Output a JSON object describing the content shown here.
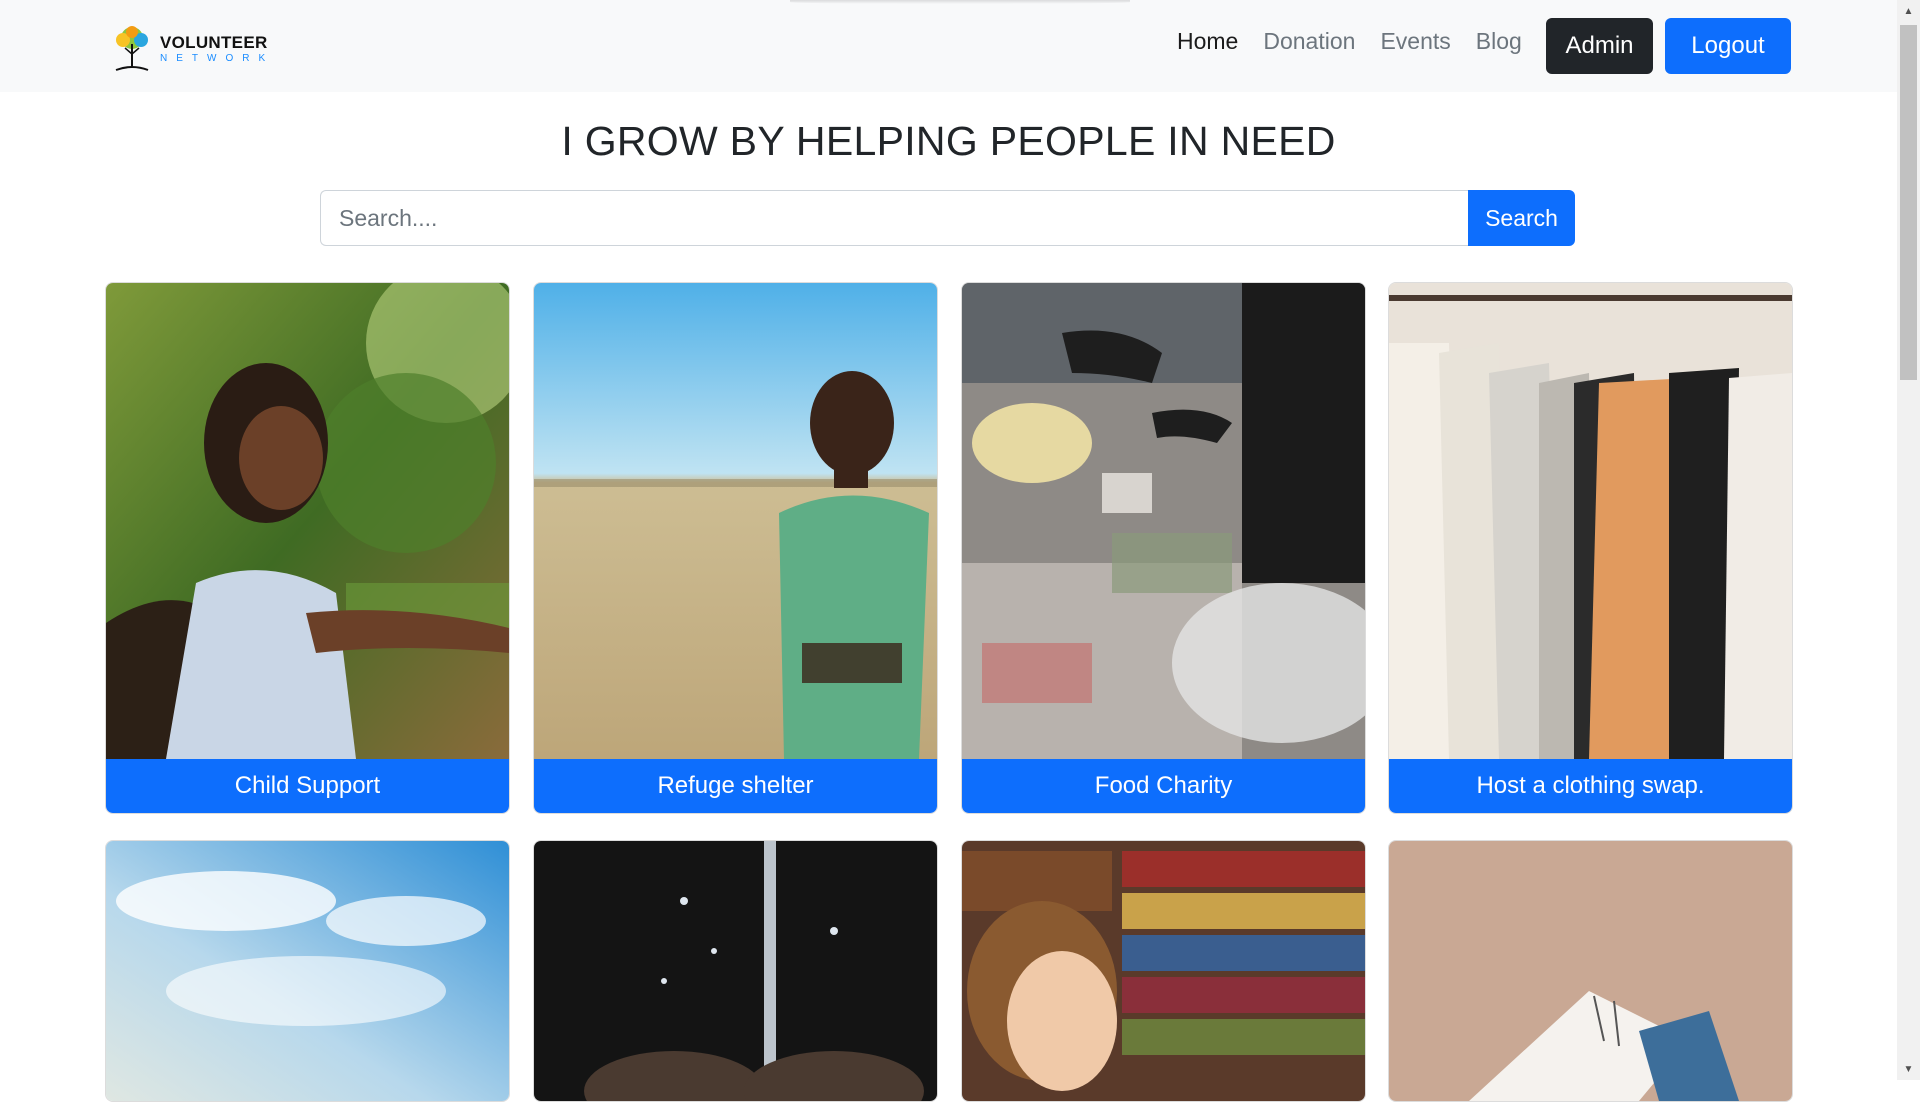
{
  "brand": {
    "title": "VOLUNTEER",
    "subtitle": "NETWORK"
  },
  "nav": {
    "links": [
      {
        "label": "Home",
        "active": true
      },
      {
        "label": "Donation"
      },
      {
        "label": "Events"
      },
      {
        "label": "Blog"
      }
    ],
    "admin_label": "Admin",
    "logout_label": "Logout"
  },
  "hero": {
    "title": "I GROW BY HELPING PEOPLE IN NEED"
  },
  "search": {
    "placeholder": "Search....",
    "button_label": "Search"
  },
  "cards": [
    {
      "label": "Child Support",
      "image": "girl-smiling-outdoors"
    },
    {
      "label": "Refuge shelter",
      "image": "boy-in-field"
    },
    {
      "label": "Food Charity",
      "image": "food-bank-volunteers"
    },
    {
      "label": "Host a clothing swap.",
      "image": "clothing-rack"
    },
    {
      "label": "",
      "image": "sky-clouds"
    },
    {
      "label": "",
      "image": "water-pouring-hands"
    },
    {
      "label": "",
      "image": "boy-in-library"
    },
    {
      "label": "",
      "image": "open-book"
    }
  ],
  "colors": {
    "primary": "#0d6efd",
    "dark": "#212529",
    "navbar": "#f8f9fa"
  }
}
